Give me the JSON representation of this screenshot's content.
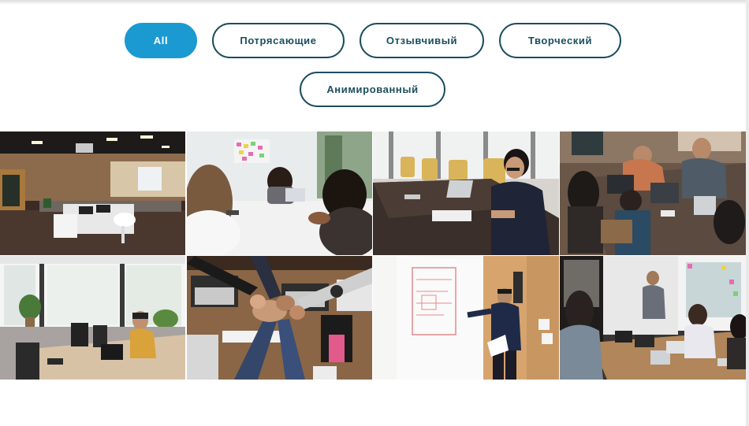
{
  "filters": {
    "buttons": [
      {
        "label": "All",
        "active": true
      },
      {
        "label": "Потрясающие",
        "active": false
      },
      {
        "label": "Отзывчивый",
        "active": false
      },
      {
        "label": "Творческий",
        "active": false
      },
      {
        "label": "Анимированный",
        "active": false
      }
    ]
  },
  "gallery": {
    "images": [
      {
        "subject": "open-plan-office"
      },
      {
        "subject": "women-meeting-at-table"
      },
      {
        "subject": "man-at-laptop-conference-room"
      },
      {
        "subject": "team-working-on-laptops"
      },
      {
        "subject": "man-at-desk-by-window"
      },
      {
        "subject": "team-fist-bump-over-desk"
      },
      {
        "subject": "man-drawing-on-whiteboard"
      },
      {
        "subject": "team-presentation-meeting"
      }
    ]
  },
  "colors": {
    "accent": "#1b9ad2",
    "button_border": "#1b4e5f",
    "button_text": "#1b4e5f"
  }
}
